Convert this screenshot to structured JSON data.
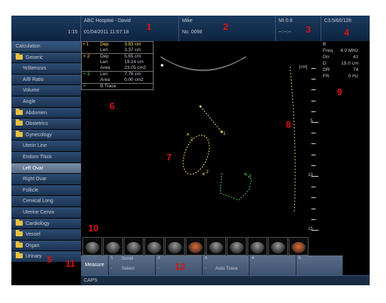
{
  "header": {
    "blank_value": "1:15",
    "patient": "ABC Hospital - David",
    "datetime": "01/04/2011 11:57:18",
    "operator": "Mike",
    "study_no": "No. 0098",
    "mi": "MI 0.8",
    "mi_sub": "--:--:--",
    "probe": "C3.5/60/128"
  },
  "sidebar": {
    "items": [
      {
        "label": "Calculation",
        "type": "head"
      },
      {
        "label": "Generic",
        "type": "folder"
      },
      {
        "label": "%Stenosis",
        "type": "sub"
      },
      {
        "label": "A/B Ratio",
        "type": "sub"
      },
      {
        "label": "Volume",
        "type": "sub"
      },
      {
        "label": "Angle",
        "type": "sub"
      },
      {
        "label": "Abdomen",
        "type": "folder"
      },
      {
        "label": "Obstetrics",
        "type": "folder"
      },
      {
        "label": "Gynecology",
        "type": "folder"
      },
      {
        "label": "Uterin Line",
        "type": "sub"
      },
      {
        "label": "Endom Thick",
        "type": "sub"
      },
      {
        "label": "Left Ovar",
        "type": "sub",
        "selected": true
      },
      {
        "label": "Right Ovar",
        "type": "sub"
      },
      {
        "label": "Follicle",
        "type": "sub"
      },
      {
        "label": "Cervical Long",
        "type": "sub"
      },
      {
        "label": "Uterine Cervix",
        "type": "sub"
      },
      {
        "label": "Cardiology",
        "type": "folder"
      },
      {
        "label": "Vessel",
        "type": "folder"
      },
      {
        "label": "Organ",
        "type": "folder"
      },
      {
        "label": "Urinary",
        "type": "folder"
      }
    ]
  },
  "measurements": {
    "m1": {
      "num": "1",
      "dep_label": "Dep",
      "dep": "3.83 cm",
      "len_label": "Len",
      "len": "3.37 cm"
    },
    "m2": {
      "num": "2",
      "dep_label": "Dep",
      "dep": "5.65 cm",
      "len_label": "Len",
      "len": "19.24 cm",
      "area_label": "Area",
      "area": "23.05 cm2"
    },
    "m3": {
      "num": "3",
      "len_label": "Len",
      "len": "7.76 cm",
      "area_label": "Area",
      "area": "0.00 cm2"
    },
    "m4": {
      "label": "B Trace"
    }
  },
  "params": {
    "mode": "B",
    "rows": [
      {
        "k": "Freq",
        "v": "4.0 MHz"
      },
      {
        "k": "Gn",
        "v": "41"
      },
      {
        "k": "D",
        "v": "15.0 cm"
      },
      {
        "k": "DR",
        "v": "74"
      },
      {
        "k": "FR",
        "v": "0 Hz"
      }
    ],
    "unit": "[cm]"
  },
  "ruler": {
    "labels": [
      "5",
      "10",
      "15"
    ]
  },
  "markers": {
    "one": "1",
    "two": "2",
    "three": "3"
  },
  "bottom": {
    "measure": "Measure",
    "softkeys": [
      {
        "n1": "1",
        "top": "Scroll",
        "n2": "-",
        "bottom": "Select"
      },
      {
        "n1": "2",
        "top": "",
        "n2": "-",
        "bottom": ""
      },
      {
        "n1": "3",
        "top": "",
        "n2": "-",
        "bottom": "Auto Trace"
      },
      {
        "n1": "4",
        "top": "",
        "n2": "",
        "bottom": ""
      },
      {
        "n1": "5",
        "top": "",
        "n2": "",
        "bottom": ""
      }
    ],
    "status": "CAPS"
  },
  "callouts": [
    "1",
    "2",
    "3",
    "4",
    "5",
    "6",
    "7",
    "8",
    "9",
    "10",
    "11",
    "12"
  ],
  "colors": {
    "header": "#1a3a5e",
    "sidebar": "#2e4c72",
    "accent_green": "#5fd35f",
    "accent_yellow": "#ffe066",
    "callout": "#e01010"
  }
}
